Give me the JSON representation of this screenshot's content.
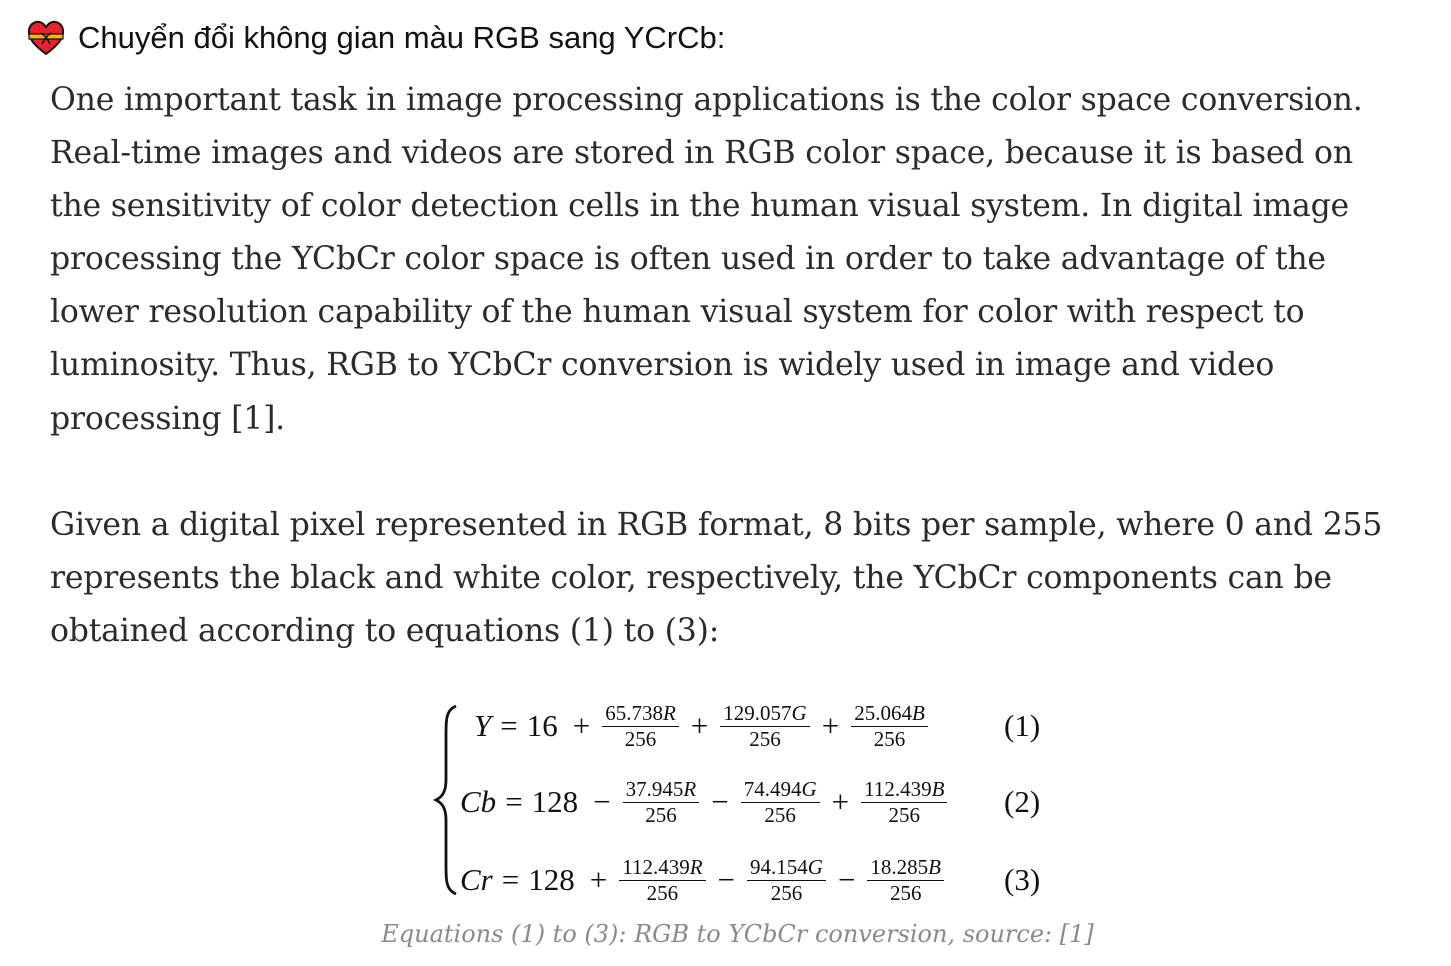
{
  "header": {
    "icon": "heart-with-ribbon-icon",
    "icon_colors": {
      "heart": "#e8232f",
      "ribbon": "#f7b500"
    },
    "title": "Chuyển đổi không gian màu RGB sang YCrCb:"
  },
  "article": {
    "paragraph1_lines": [
      "One important task in image processing applications is the color space conversion.",
      "Real-time images and videos are stored in RGB color space, because it is based on",
      "the sensitivity of color detection cells in the human visual system. In digital image",
      "processing the YCbCr color space is often used in order to take advantage of the",
      "lower resolution capability of the human visual system for color with respect to",
      "luminosity. Thus, RGB to YCbCr conversion is widely used in image and video",
      "processing [1]."
    ],
    "paragraph2_lines": [
      "Given a digital pixel represented in RGB format, 8 bits per sample, where 0 and 255",
      "represents the black and white color, respectively, the YCbCr components can be",
      "obtained according to equations (1) to (3):"
    ]
  },
  "equations": [
    {
      "lhs": "Y",
      "eq": "=",
      "const": "16",
      "op0": "+",
      "t1": {
        "num": "65.738",
        "var": "R",
        "den": "256"
      },
      "op1": "+",
      "t2": {
        "num": "129.057",
        "var": "G",
        "den": "256"
      },
      "op2": "+",
      "t3": {
        "num": "25.064",
        "var": "B",
        "den": "256"
      },
      "label": "(1)"
    },
    {
      "lhs": "Cb",
      "eq": "=",
      "const": "128",
      "op0": "−",
      "t1": {
        "num": "37.945",
        "var": "R",
        "den": "256"
      },
      "op1": "−",
      "t2": {
        "num": "74.494",
        "var": "G",
        "den": "256"
      },
      "op2": "+",
      "t3": {
        "num": "112.439",
        "var": "B",
        "den": "256"
      },
      "label": "(2)"
    },
    {
      "lhs": "Cr",
      "eq": "=",
      "const": "128",
      "op0": "+",
      "t1": {
        "num": "112.439",
        "var": "R",
        "den": "256"
      },
      "op1": "−",
      "t2": {
        "num": "94.154",
        "var": "G",
        "den": "256"
      },
      "op2": "−",
      "t3": {
        "num": "18.285",
        "var": "B",
        "den": "256"
      },
      "label": "(3)"
    }
  ],
  "caption": "Equations (1) to (3): RGB to YCbCr conversion, source: [1]"
}
